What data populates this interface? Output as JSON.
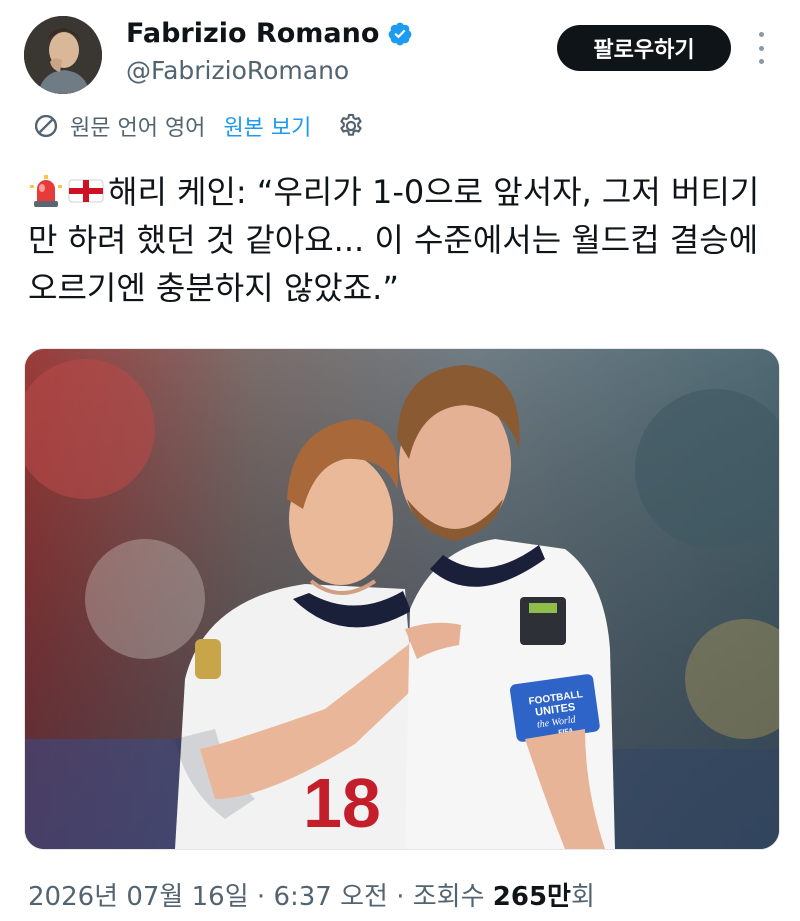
{
  "author": {
    "display_name": "Fabrizio Romano",
    "handle": "@FabrizioRomano",
    "verified": true,
    "avatar_icon": "profile-photo"
  },
  "actions": {
    "follow_label": "팔로우하기",
    "more_icon": "more-vertical-icon"
  },
  "translation": {
    "info": "원문 언어 영어",
    "show_original": "원본 보기",
    "settings_icon": "gear-icon"
  },
  "tweet": {
    "emojis": [
      "rotating-light-emoji",
      "england-flag-emoji"
    ],
    "text": "해리 케인: “우리가 1-0으로 앞서자, 그저 버티기만 하려 했던 것 같아요... 이 수준에서는 월드컵 결승에 오르기엔 충분하지 않았죠.”"
  },
  "media": {
    "type": "photo",
    "jersey_number": "18",
    "armband_text_lines": [
      "FOOTBALL",
      "UNITES",
      "the World",
      "FIFA"
    ]
  },
  "meta": {
    "date": "2026년 07월 16일",
    "separator": " · ",
    "time": "6:37 오전",
    "views_label": "조회수",
    "views_count": "265만",
    "views_suffix": "회"
  },
  "colors": {
    "accent": "#1d9bf0",
    "text": "#0f1419",
    "muted": "#536471",
    "button_bg": "#0f1419"
  }
}
